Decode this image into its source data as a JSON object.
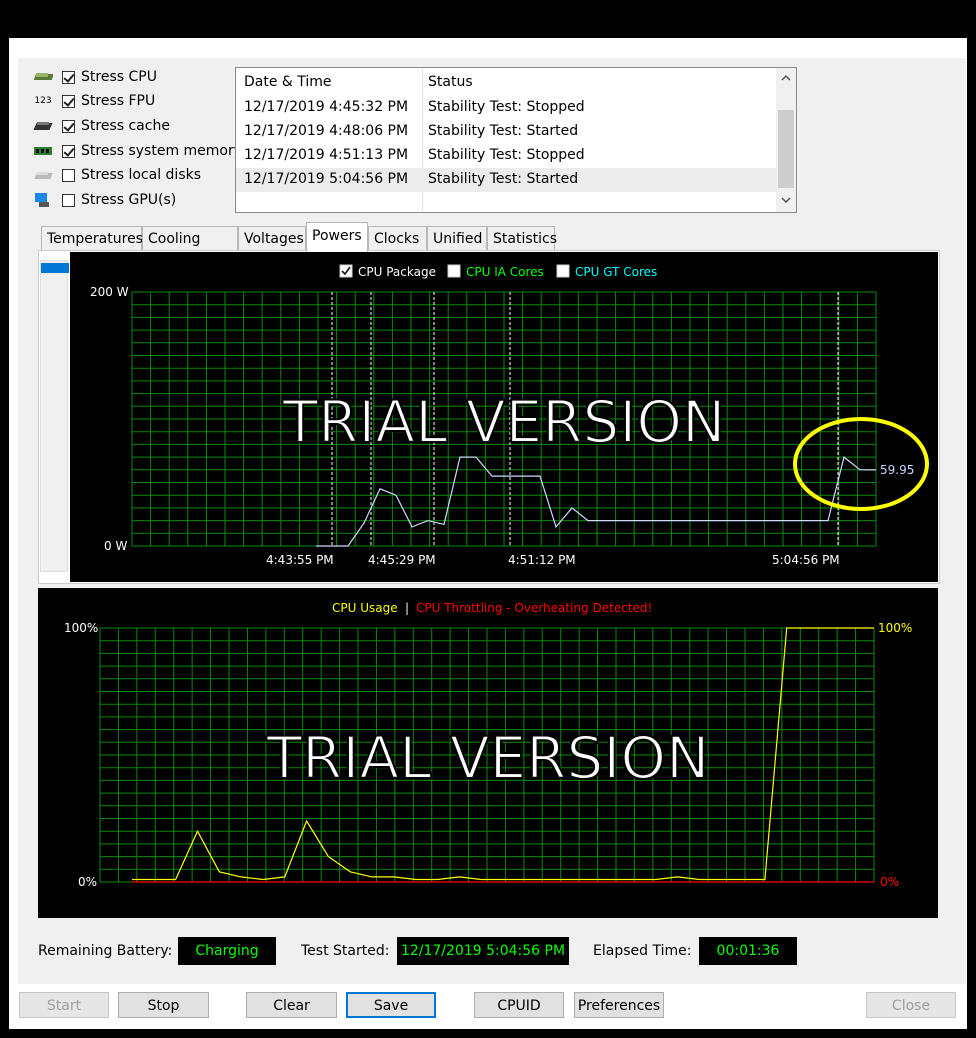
{
  "stress": [
    {
      "label": "Stress CPU",
      "checked": true,
      "icon": "cpu-icon"
    },
    {
      "label": "Stress FPU",
      "checked": true,
      "icon": "fpu-icon"
    },
    {
      "label": "Stress cache",
      "checked": true,
      "icon": "cache-icon"
    },
    {
      "label": "Stress system memory",
      "checked": true,
      "icon": "memory-icon"
    },
    {
      "label": "Stress local disks",
      "checked": false,
      "icon": "disk-icon"
    },
    {
      "label": "Stress GPU(s)",
      "checked": false,
      "icon": "gpu-icon"
    }
  ],
  "fpu_icon_text": "123",
  "log": {
    "headers": [
      "Date & Time",
      "Status"
    ],
    "rows": [
      [
        "12/17/2019 4:45:32 PM",
        "Stability Test: Stopped"
      ],
      [
        "12/17/2019 4:48:06 PM",
        "Stability Test: Started"
      ],
      [
        "12/17/2019 4:51:13 PM",
        "Stability Test: Stopped"
      ],
      [
        "12/17/2019 5:04:56 PM",
        "Stability Test: Started"
      ]
    ]
  },
  "tabs": [
    "Temperatures",
    "Cooling Fans",
    "Voltages",
    "Powers",
    "Clocks",
    "Unified",
    "Statistics"
  ],
  "active_tab": "Powers",
  "power_chart": {
    "legend": [
      {
        "label": "CPU Package",
        "checked": true,
        "color": "#ffffff"
      },
      {
        "label": "CPU IA Cores",
        "checked": false,
        "color": "#00ff00"
      },
      {
        "label": "CPU GT Cores",
        "checked": false,
        "color": "#00ffff"
      }
    ],
    "y_max_label": "200 W",
    "y_min_label": "0 W",
    "x_labels": [
      "4:43:55 PM",
      "4:45:29 PM",
      "4:51:12 PM",
      "5:04:56 PM"
    ],
    "watermark": "TRIAL VERSION",
    "current_value": "59.95",
    "highlight_color": "#ffff00"
  },
  "chart_data": [
    {
      "type": "line",
      "title": "",
      "ylabel": "",
      "ylim": [
        0,
        200
      ],
      "series": [
        {
          "name": "CPU Package",
          "values": [
            0,
            0,
            0,
            18,
            45,
            40,
            15,
            20,
            17,
            70,
            70,
            55,
            55,
            55,
            55,
            15,
            30,
            20,
            20,
            20,
            20,
            20,
            20,
            20,
            20,
            20,
            20,
            20,
            20,
            20,
            20,
            20,
            20,
            70,
            60,
            59.95
          ]
        }
      ]
    },
    {
      "type": "line",
      "title": "",
      "ylabel": "",
      "ylim": [
        0,
        100
      ],
      "series": [
        {
          "name": "CPU Usage",
          "values": [
            1,
            1,
            1,
            20,
            4,
            2,
            1,
            2,
            24,
            10,
            4,
            2,
            2,
            1,
            1,
            2,
            1,
            1,
            1,
            1,
            1,
            1,
            1,
            1,
            1,
            2,
            1,
            1,
            1,
            1,
            100,
            100,
            100,
            100,
            100
          ]
        },
        {
          "name": "CPU Throttling",
          "values": [
            0,
            0,
            0,
            0,
            0,
            0,
            0,
            0,
            0,
            0,
            0,
            0,
            0,
            0,
            0,
            0,
            0,
            0,
            0,
            0,
            0,
            0,
            0,
            0,
            0,
            0,
            0,
            0,
            0,
            0,
            0,
            0,
            0,
            0,
            0
          ]
        }
      ]
    }
  ],
  "usage_chart": {
    "legend_usage": "CPU Usage",
    "legend_sep": "|",
    "legend_throttle": "CPU Throttling - Overheating Detected!",
    "y_max_left": "100%",
    "y_min_left": "0%",
    "y_max_right": "100%",
    "y_min_right": "0%",
    "watermark": "TRIAL VERSION",
    "usage_color": "#ffff00",
    "throttle_color": "#ff0000"
  },
  "status": {
    "battery_label": "Remaining Battery:",
    "battery_value": "Charging",
    "started_label": "Test Started:",
    "started_value": "12/17/2019 5:04:56 PM",
    "elapsed_label": "Elapsed Time:",
    "elapsed_value": "00:01:36"
  },
  "buttons": {
    "start": "Start",
    "stop": "Stop",
    "clear": "Clear",
    "save": "Save",
    "cpuid": "CPUID",
    "preferences": "Preferences",
    "close": "Close"
  }
}
